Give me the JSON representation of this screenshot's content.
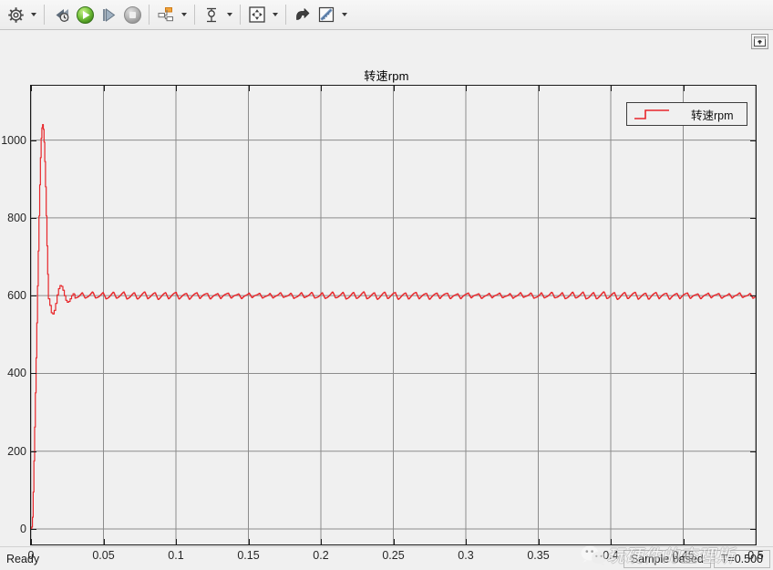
{
  "toolbar": {
    "buttons": [
      {
        "name": "configuration-properties-button",
        "icon": "gear-icon",
        "has_caret": true
      },
      {
        "name": "step-back-button",
        "icon": "step-back-icon",
        "has_caret": false
      },
      {
        "name": "run-button",
        "icon": "play-icon",
        "has_caret": false
      },
      {
        "name": "step-forward-button",
        "icon": "step-forward-icon",
        "has_caret": false
      },
      {
        "name": "stop-button",
        "icon": "stop-icon",
        "has_caret": false
      },
      {
        "name": "signal-selection-button",
        "icon": "signal-blocks-icon",
        "has_caret": true
      },
      {
        "name": "cursor-measurements-button",
        "icon": "cursor-measure-icon",
        "has_caret": true
      },
      {
        "name": "autoscale-button",
        "icon": "fit-to-view-icon",
        "has_caret": true
      },
      {
        "name": "zoom-in-button",
        "icon": "zoom-arrow-icon",
        "has_caret": false
      },
      {
        "name": "style-button",
        "icon": "ruler-pencil-icon",
        "has_caret": true
      }
    ]
  },
  "scope": {
    "title": "转速rpm",
    "dock_icon": "undock-window-icon"
  },
  "legend": {
    "entries": [
      {
        "label": "转速rpm",
        "color": "#e8262a"
      }
    ]
  },
  "watermark": {
    "text": "玩硬件的查理斯",
    "icon": "wechat-icon"
  },
  "statusbar": {
    "status": "Ready",
    "frame_mode": "Sample based",
    "time": "T=0.500"
  },
  "chart_data": {
    "type": "line",
    "title": "转速rpm",
    "xlabel": "",
    "ylabel": "",
    "xlim": [
      0,
      0.5
    ],
    "ylim": [
      -40,
      1140
    ],
    "grid": true,
    "legend_position": "top-right",
    "xticks": [
      0,
      0.05,
      0.1,
      0.15,
      0.2,
      0.25,
      0.3,
      0.35,
      0.4,
      0.45,
      0.5
    ],
    "xtick_labels": [
      "0",
      "0.05",
      "0.1",
      "0.15",
      "0.2",
      "0.25",
      "0.3",
      "0.35",
      "0.4",
      "0.45",
      "0.5"
    ],
    "yticks": [
      0,
      200,
      400,
      600,
      800,
      1000
    ],
    "ytick_labels": [
      "0",
      "200",
      "400",
      "600",
      "800",
      "1000"
    ],
    "series": [
      {
        "name": "转速rpm",
        "color": "#e8262a",
        "line_width": 1.2,
        "setpoint": 600,
        "overshoot_peak": 1040,
        "peak_time": 0.008,
        "undershoot_min": 553,
        "settling_time": 0.03,
        "ripple_amplitude": 9,
        "ripple_period": 0.0072,
        "x": [
          0,
          0.0005,
          0.001,
          0.0015,
          0.002,
          0.0025,
          0.003,
          0.0035,
          0.004,
          0.0045,
          0.005,
          0.0055,
          0.006,
          0.0065,
          0.007,
          0.0075,
          0.008,
          0.0085,
          0.009,
          0.0095,
          0.01,
          0.0105,
          0.011,
          0.0115,
          0.012,
          0.013,
          0.014,
          0.015,
          0.016,
          0.017,
          0.018,
          0.019,
          0.02,
          0.021,
          0.022,
          0.023,
          0.024,
          0.025,
          0.026,
          0.027,
          0.028,
          0.029,
          0.03
        ],
        "y": [
          0,
          5,
          30,
          95,
          175,
          262,
          350,
          440,
          530,
          625,
          715,
          805,
          885,
          955,
          1005,
          1032,
          1040,
          1028,
          995,
          945,
          880,
          805,
          728,
          655,
          592,
          575,
          556,
          553,
          562,
          580,
          602,
          618,
          626,
          624,
          614,
          600,
          588,
          583,
          585,
          592,
          600,
          605,
          603
        ]
      }
    ]
  }
}
